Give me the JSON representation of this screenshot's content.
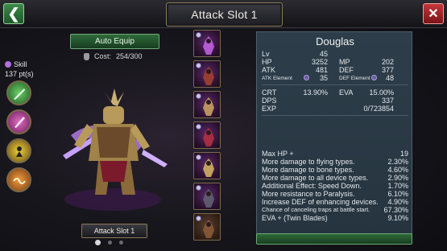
{
  "header": {
    "title": "Attack Slot 1"
  },
  "left": {
    "auto_equip_label": "Auto Equip",
    "cost_label": "Cost:",
    "cost_value": "254/300",
    "skill_label": "Skill",
    "skill_points": "137 pt(s)",
    "slot_name": "Attack Slot 1",
    "pager": {
      "pages": 3,
      "active": 1
    }
  },
  "skill_icons": [
    "green-blade-skill-icon",
    "pink-blade-skill-icon",
    "yellow-strike-skill-icon",
    "orange-wave-skill-icon"
  ],
  "card_slots": [
    {
      "icon": "purple-armor-card-icon",
      "selected": true
    },
    {
      "icon": "horned-beast-card-icon",
      "selected": false
    },
    {
      "icon": "winged-warrior-card-icon",
      "selected": false
    },
    {
      "icon": "red-knight-card-icon",
      "selected": false
    },
    {
      "icon": "golden-knight-card-icon",
      "selected": false
    },
    {
      "icon": "shadow-rider-card-icon",
      "selected": false
    },
    {
      "icon": "dark-armor-card-icon",
      "selected": false
    }
  ],
  "panel": {
    "name": "Douglas",
    "lv_label": "Lv",
    "lv": "45",
    "hp_label": "HP",
    "hp": "3252",
    "mp_label": "MP",
    "mp": "202",
    "atk_label": "ATK",
    "atk": "481",
    "def_label": "DEF",
    "def": "377",
    "atk_element_label": "ATK Element",
    "atk_element": "35",
    "def_element_label": "DEF Element",
    "def_element": "48",
    "crt_label": "CRT",
    "crt": "13.90%",
    "eva_label": "EVA",
    "eva": "15.00%",
    "dps_label": "DPS",
    "dps": "337",
    "exp_label": "EXP",
    "exp": "0/723854",
    "options": [
      {
        "label": "Max HP +",
        "value": "19"
      },
      {
        "label": "More damage to flying types.",
        "value": "2.30%"
      },
      {
        "label": "More damage to bone types.",
        "value": "4.60%"
      },
      {
        "label": "More damage to all device types.",
        "value": "2.90%"
      },
      {
        "label": "Additional Effect: Speed Down.",
        "value": "1.70%"
      },
      {
        "label": "More resistance to Paralysis.",
        "value": "6.10%"
      },
      {
        "label": "Increase DEF of enhancing devices.",
        "value": "4.90%"
      },
      {
        "label": "Chance of canceling traps at battle start.",
        "value": "67.30%"
      },
      {
        "label": "EVA + (Twin Blades)",
        "value": "9.10%"
      }
    ]
  }
}
